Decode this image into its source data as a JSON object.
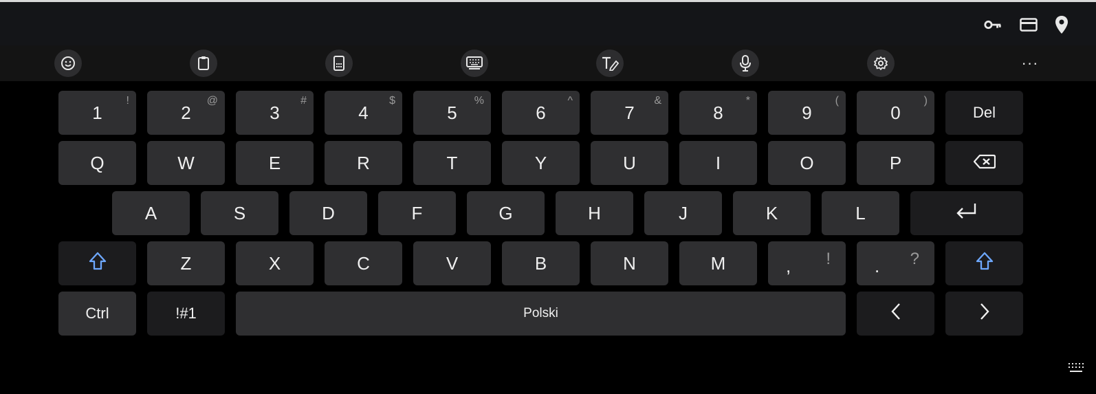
{
  "autofill_bar": {
    "icons": [
      "key-icon",
      "credit-card-icon",
      "location-pin-icon"
    ]
  },
  "toolbar": {
    "buttons": [
      "emoji-icon",
      "clipboard-icon",
      "one-handed-icon",
      "keyboard-mode-icon",
      "handwriting-icon",
      "microphone-icon",
      "settings-icon"
    ],
    "more_label": "···"
  },
  "keyboard": {
    "row1": [
      {
        "main": "1",
        "sub": "!"
      },
      {
        "main": "2",
        "sub": "@"
      },
      {
        "main": "3",
        "sub": "#"
      },
      {
        "main": "4",
        "sub": "$"
      },
      {
        "main": "5",
        "sub": "%"
      },
      {
        "main": "6",
        "sub": "^"
      },
      {
        "main": "7",
        "sub": "&"
      },
      {
        "main": "8",
        "sub": "*"
      },
      {
        "main": "9",
        "sub": "("
      },
      {
        "main": "0",
        "sub": ")"
      }
    ],
    "del_label": "Del",
    "row2": [
      "Q",
      "W",
      "E",
      "R",
      "T",
      "Y",
      "U",
      "I",
      "O",
      "P"
    ],
    "row3": [
      "A",
      "S",
      "D",
      "F",
      "G",
      "H",
      "J",
      "K",
      "L"
    ],
    "row4": [
      "Z",
      "X",
      "C",
      "V",
      "B",
      "N",
      "M"
    ],
    "comma": {
      "main": ",",
      "sub": "!"
    },
    "period": {
      "main": ".",
      "sub": "?"
    },
    "ctrl_label": "Ctrl",
    "symbols_label": "!#1",
    "space_label": "Polski",
    "left_arrow": "‹",
    "right_arrow": "›",
    "accent_color": "#6ea8ff"
  }
}
